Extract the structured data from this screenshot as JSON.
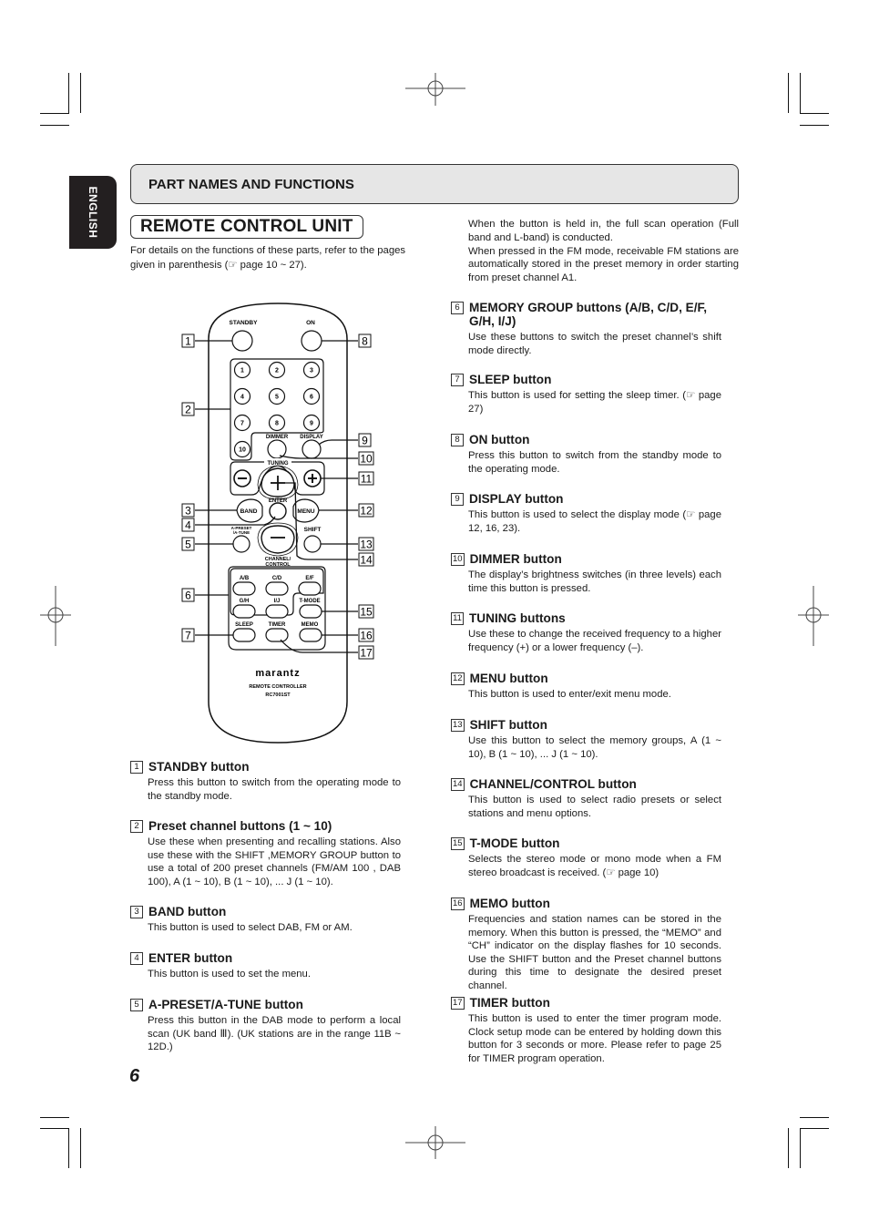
{
  "side_tab": {
    "label": "ENGLISH"
  },
  "section_header": {
    "title": "PART NAMES AND FUNCTIONS"
  },
  "unit_title": "REMOTE CONTROL UNIT",
  "intro_text": "For details on the functions of these parts, refer to the pages given in parenthesis (☞ page 10 ~ 27).",
  "continued_text": [
    "When the button is held in, the full scan operation (Full band and L-band) is conducted.",
    "When pressed in the FM mode, receivable FM stations are automatically stored in the preset memory in order starting from preset channel A1."
  ],
  "remote": {
    "labels": {
      "standby": "STANDBY",
      "on": "ON",
      "digits": [
        "1",
        "2",
        "3",
        "4",
        "5",
        "6",
        "7",
        "8",
        "9",
        "10"
      ],
      "dimmer": "DIMMER",
      "display": "DISPLAY",
      "tuning": "TUNING",
      "band": "BAND",
      "menu": "MENU",
      "enter": "ENTER",
      "apreset": "A-PRESET",
      "atune": "/A-TUNE",
      "shift": "SHIFT",
      "channel": "CHANNEL/",
      "control": "CONTROL",
      "memory_groups": [
        "A/B",
        "C/D",
        "E/F",
        "G/H",
        "I/J"
      ],
      "tmode": "T-MODE",
      "sleep": "SLEEP",
      "timer": "TIMER",
      "memo": "MEMO",
      "brand": "marantz",
      "model_line1": "REMOTE CONTROLLER",
      "model_line2": "RC7001ST"
    },
    "callouts_left": [
      "1",
      "2",
      "3",
      "4",
      "5",
      "6",
      "7"
    ],
    "callouts_right": [
      "8",
      "9",
      "10",
      "11",
      "12",
      "13",
      "14",
      "15",
      "16",
      "17"
    ]
  },
  "items_left": [
    {
      "num": "1",
      "title": "STANDBY button",
      "desc": "Press this button to switch from the operating mode to the standby mode."
    },
    {
      "num": "2",
      "title": "Preset channel buttons (1 ~ 10)",
      "desc": "Use these when presenting and recalling stations. Also use these with the SHIFT ,MEMORY GROUP button to use a total of 200 preset channels (FM/AM 100 , DAB 100), A (1 ~ 10), B (1 ~ 10), ... J (1 ~ 10)."
    },
    {
      "num": "3",
      "title": "BAND button",
      "desc": "This button is used to select DAB, FM or AM."
    },
    {
      "num": "4",
      "title": "ENTER button",
      "desc": "This button is used to set the menu."
    },
    {
      "num": "5",
      "title": "A-PRESET/A-TUNE button",
      "desc": "Press this button in the DAB mode to perform a local scan (UK band Ⅲ). (UK stations are in the range 11B ~ 12D.)"
    }
  ],
  "items_right": [
    {
      "num": "6",
      "title": "MEMORY GROUP buttons (A/B, C/D, E/F, G/H, I/J)",
      "desc": "Use these buttons to switch the preset channel’s shift mode directly."
    },
    {
      "num": "7",
      "title": "SLEEP button",
      "desc": "This button is used for setting the sleep timer. (☞ page 27)"
    },
    {
      "num": "8",
      "title": "ON button",
      "desc": "Press this button to switch from the standby mode to the operating mode."
    },
    {
      "num": "9",
      "title": "DISPLAY button",
      "desc": "This button is used to select the display mode (☞ page 12, 16, 23)."
    },
    {
      "num": "10",
      "title": "DIMMER button",
      "desc": "The display’s brightness switches (in three levels) each time this button is pressed."
    },
    {
      "num": "11",
      "title": "TUNING buttons",
      "desc": "Use these to change the received frequency to a higher frequency (+) or a lower frequency (–)."
    },
    {
      "num": "12",
      "title": "MENU button",
      "desc": "This button is used to enter/exit menu mode."
    },
    {
      "num": "13",
      "title": "SHIFT button",
      "desc": "Use this button to select the memory groups, A (1 ~ 10), B (1 ~ 10), ... J (1 ~ 10)."
    },
    {
      "num": "14",
      "title": "CHANNEL/CONTROL button",
      "desc": "This button is used to select radio presets or select stations and menu options."
    },
    {
      "num": "15",
      "title": "T-MODE button",
      "desc": "Selects the stereo mode or mono mode when a FM stereo broadcast is received. (☞ page 10)"
    },
    {
      "num": "16",
      "title": "MEMO button",
      "desc": "Frequencies and station names can be stored in the memory. When this button is pressed, the “MEMO” and “CH” indicator on the display flashes for 10 seconds. Use the SHIFT button and the Preset channel buttons during this time to designate the desired preset channel."
    },
    {
      "num": "17",
      "title": "TIMER button",
      "desc": "This button is used to enter the timer program mode. Clock setup mode can be entered by holding down this button for 3 seconds or more. Please refer to page 25 for TIMER program operation."
    }
  ],
  "page_number": "6"
}
